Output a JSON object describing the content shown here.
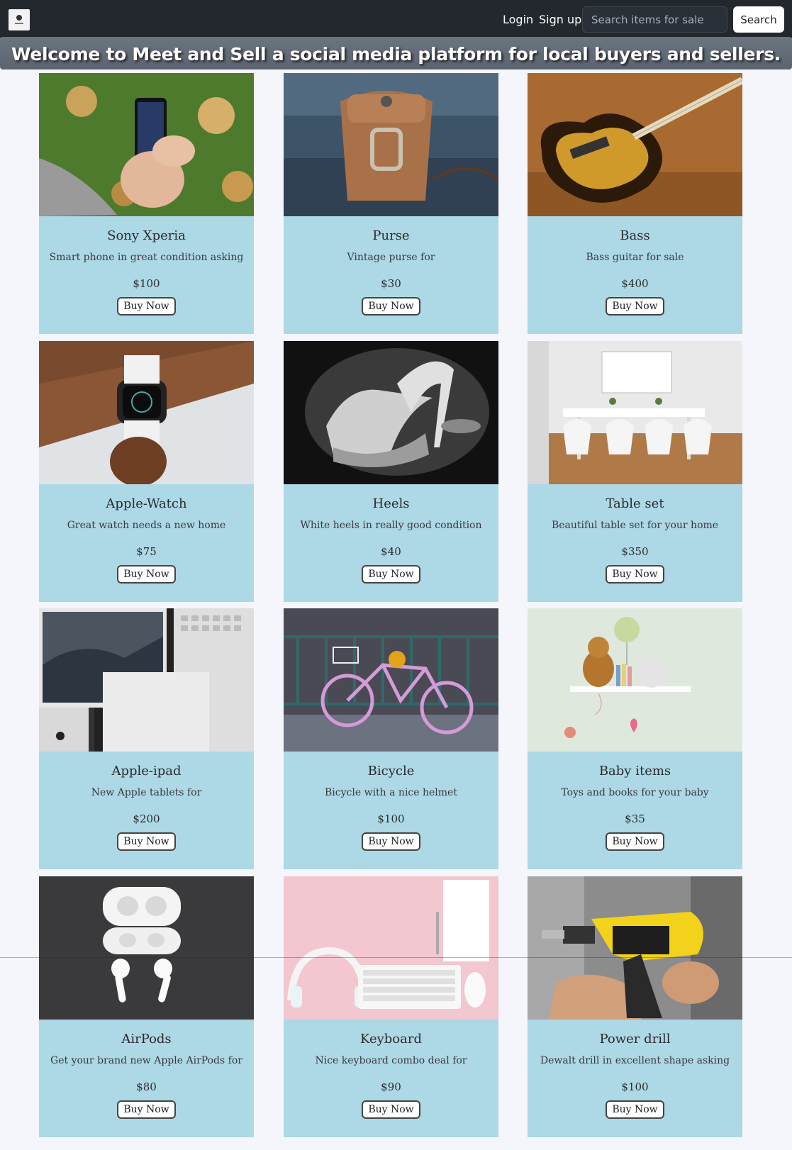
{
  "navbar": {
    "login_label": "Login",
    "signup_label": "Sign up",
    "search_placeholder": "Search items for sale",
    "search_button_label": "Search"
  },
  "banner": {
    "text": "Welcome to Meet and Sell a social media platform for local buyers and sellers."
  },
  "colors": {
    "navbar_bg": "#23282f",
    "card_bg": "#add8e6",
    "page_bg": "#f4f6fb"
  },
  "items": [
    {
      "title": "Sony Xperia",
      "description": "Smart phone in great condition asking",
      "price": "$100",
      "button": "Buy Now",
      "image": "phone-photo"
    },
    {
      "title": "Purse",
      "description": "Vintage purse for",
      "price": "$30",
      "button": "Buy Now",
      "image": "purse-photo"
    },
    {
      "title": "Bass",
      "description": "Bass guitar for sale",
      "price": "$400",
      "button": "Buy Now",
      "image": "bass-guitar-photo"
    },
    {
      "title": "Apple-Watch",
      "description": "Great watch needs a new home",
      "price": "$75",
      "button": "Buy Now",
      "image": "watch-photo"
    },
    {
      "title": "Heels",
      "description": "White heels in really good condition",
      "price": "$40",
      "button": "Buy Now",
      "image": "heels-photo"
    },
    {
      "title": "Table set",
      "description": "Beautiful table set for your home",
      "price": "$350",
      "button": "Buy Now",
      "image": "table-set-photo"
    },
    {
      "title": "Apple-ipad",
      "description": "New Apple tablets for",
      "price": "$200",
      "button": "Buy Now",
      "image": "ipad-photo"
    },
    {
      "title": "Bicycle",
      "description": "Bicycle with a nice helmet",
      "price": "$100",
      "button": "Buy Now",
      "image": "bicycle-photo"
    },
    {
      "title": "Baby items",
      "description": "Toys and books for your baby",
      "price": "$35",
      "button": "Buy Now",
      "image": "baby-items-photo"
    },
    {
      "title": "AirPods",
      "description": "Get your brand new Apple AirPods for",
      "price": "$80",
      "button": "Buy Now",
      "image": "airpods-photo"
    },
    {
      "title": "Keyboard",
      "description": "Nice keyboard combo deal for",
      "price": "$90",
      "button": "Buy Now",
      "image": "keyboard-photo"
    },
    {
      "title": "Power drill",
      "description": "Dewalt drill in excellent shape asking",
      "price": "$100",
      "button": "Buy Now",
      "image": "power-drill-photo"
    }
  ]
}
